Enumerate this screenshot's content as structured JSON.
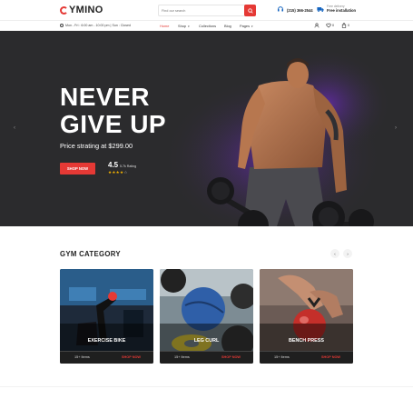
{
  "brand": {
    "logo_text": "YMINO"
  },
  "search": {
    "placeholder": "Find our search"
  },
  "contact": {
    "phone_value": "(215) 366-2544",
    "delivery_label": "Free delivery",
    "delivery_value": "Free installation"
  },
  "topbar": {
    "hours": "Mon - Fri : 6:00 am - 10:00 pm | Sun : Closed"
  },
  "nav": {
    "items": [
      {
        "label": "Home"
      },
      {
        "label": "Shop"
      },
      {
        "label": "Collections"
      },
      {
        "label": "Blog"
      },
      {
        "label": "Pages"
      }
    ]
  },
  "tools": {
    "wishlist_count": "0",
    "cart_count": "0"
  },
  "hero": {
    "headline_line1": "NEVER",
    "headline_line2": "GIVE UP",
    "price": "Price strating at $299.00",
    "cta": "SHOP NOW",
    "rating_value": "4.5",
    "rating_text": "5.7k Rating",
    "stars_filled": "★★★★",
    "stars_empty": "☆",
    "accent_color": "#e53935"
  },
  "category": {
    "title": "GYM CATEGORY",
    "cards": [
      {
        "name": "EXERCISE BIKE",
        "items": "15+ Items",
        "shop": "SHOP NOW"
      },
      {
        "name": "LEG CURL",
        "items": "15+ Items",
        "shop": "SHOP NOW"
      },
      {
        "name": "BENCH PRESS",
        "items": "15+ Items",
        "shop": "SHOP NOW"
      }
    ]
  }
}
